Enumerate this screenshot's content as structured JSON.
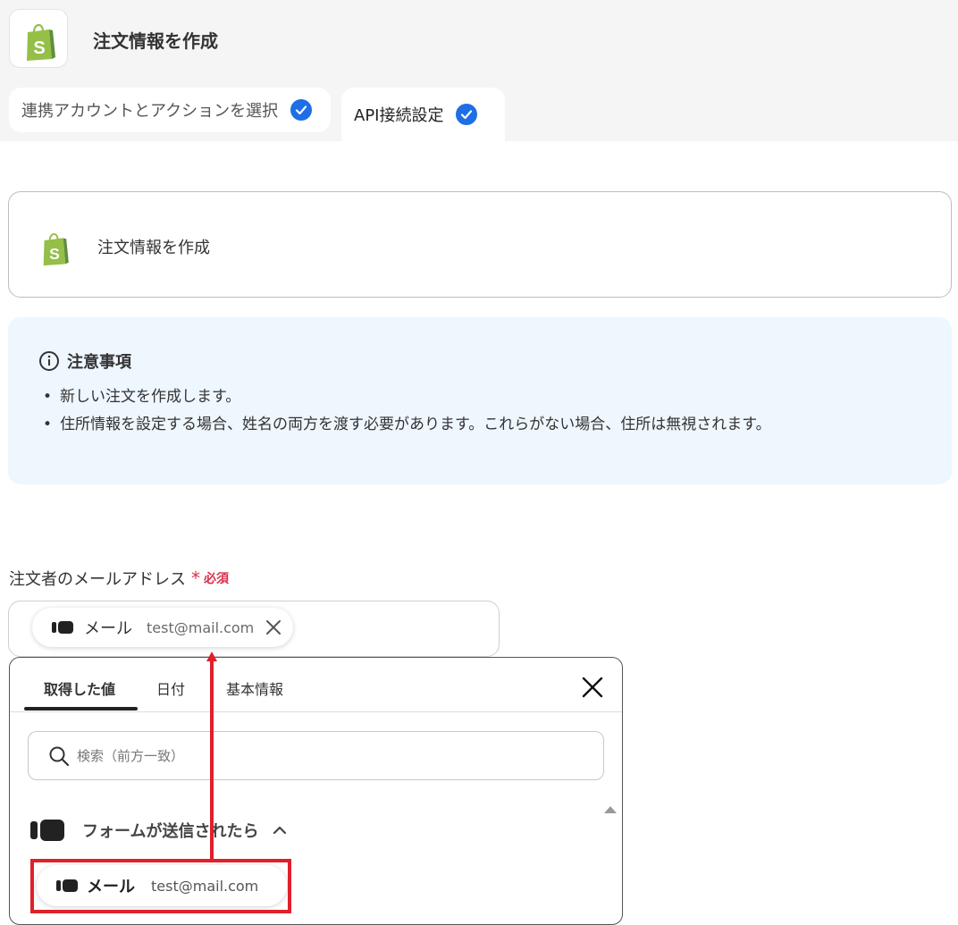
{
  "header": {
    "title": "注文情報を作成",
    "app_icon": "shopify-bag-icon",
    "tabs": [
      {
        "label": "連携アカウントとアクションを選択",
        "checked": true
      },
      {
        "label": "API接続設定",
        "checked": true
      }
    ]
  },
  "action_card": {
    "title": "注文情報を作成",
    "icon": "shopify-bag-icon"
  },
  "notice": {
    "heading": "注意事項",
    "items": [
      "新しい注文を作成します。",
      "住所情報を設定する場合、姓名の両方を渡す必要があります。これらがない場合、住所は無視されます。"
    ]
  },
  "field": {
    "label": "注文者のメールアドレス",
    "required_mark": "*",
    "required_text": "必須",
    "chip": {
      "name": "メール",
      "value": "test@mail.com"
    }
  },
  "dropdown": {
    "tabs": [
      "取得した値",
      "日付",
      "基本情報"
    ],
    "active_tab": "取得した値",
    "search_placeholder": "検索（前方一致）",
    "group": {
      "label": "フォームが送信されたら"
    },
    "item": {
      "name": "メール",
      "value": "test@mail.com"
    }
  },
  "colors": {
    "accent": "#1e6ee6",
    "required": "#d9304c",
    "highlight": "#e0202a",
    "notice_bg": "#eef6fe"
  }
}
